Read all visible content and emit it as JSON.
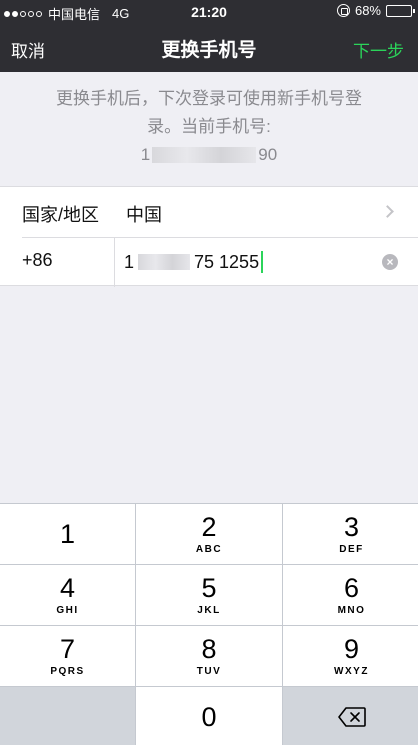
{
  "status_bar": {
    "carrier": "中国电信",
    "network": "4G",
    "time": "21:20",
    "battery": "68%",
    "battery_level": 0.68
  },
  "nav": {
    "cancel": "取消",
    "title": "更换手机号",
    "next": "下一步"
  },
  "hint": {
    "line1": "更换手机后，下次登录可使用新手机号登",
    "line2": "录。当前手机号:",
    "phone_prefix": "1",
    "phone_suffix": "90"
  },
  "form": {
    "region_label": "国家/地区",
    "region_value": "中国",
    "country_code": "+86",
    "phone_prefix": "1",
    "phone_suffix": "75 1255"
  },
  "keypad": {
    "keys": [
      {
        "digit": "1",
        "letters": ""
      },
      {
        "digit": "2",
        "letters": "ABC"
      },
      {
        "digit": "3",
        "letters": "DEF"
      },
      {
        "digit": "4",
        "letters": "GHI"
      },
      {
        "digit": "5",
        "letters": "JKL"
      },
      {
        "digit": "6",
        "letters": "MNO"
      },
      {
        "digit": "7",
        "letters": "PQRS"
      },
      {
        "digit": "8",
        "letters": "TUV"
      },
      {
        "digit": "9",
        "letters": "WXYZ"
      },
      {
        "digit": "0",
        "letters": ""
      }
    ]
  },
  "colors": {
    "accent": "#2bd45a",
    "nav_bg": "#2e2e33",
    "page_bg": "#efeff4"
  }
}
